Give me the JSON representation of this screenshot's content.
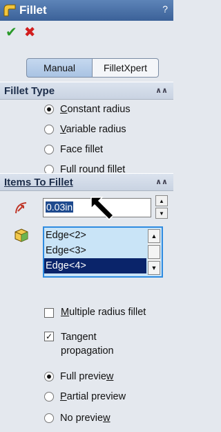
{
  "title": "Fillet",
  "help_label": "?",
  "actions": {
    "ok_glyph": "✔",
    "cancel_glyph": "✖"
  },
  "tabs": [
    {
      "label": "Manual",
      "active": true
    },
    {
      "label": "FilletXpert",
      "active": false
    }
  ],
  "fillet_type": {
    "header": "Fillet Type",
    "options": [
      {
        "access_key": "C",
        "rest": "onstant radius",
        "selected": true
      },
      {
        "access_key": "V",
        "rest": "ariable radius",
        "selected": false
      },
      {
        "prefix": "Face fillet",
        "selected": false
      },
      {
        "access_key": "F",
        "rest": "ull round fillet",
        "selected": false
      }
    ]
  },
  "items_to_fillet": {
    "header": "Items To Fillet",
    "radius_value": "0.03in",
    "edges": [
      "Edge<2>",
      "Edge<3>",
      "Edge<4>"
    ],
    "selected_edge_index": 2,
    "multiple_radius": {
      "access_key": "M",
      "rest": "ultiple radius fillet",
      "checked": false
    },
    "tangent_propagation": {
      "line1": "Tangent",
      "line2": "propagation",
      "checked": true
    },
    "preview": [
      {
        "pre": "Full previe",
        "access_key": "w",
        "selected": true
      },
      {
        "access_key": "P",
        "rest": "artial preview",
        "selected": false
      },
      {
        "pre": "No previe",
        "access_key": "w",
        "selected": false
      }
    ]
  },
  "colors": {
    "title_bar": "#3b6198",
    "selection": "#0a246a",
    "list_bg": "#c9e4f7"
  }
}
